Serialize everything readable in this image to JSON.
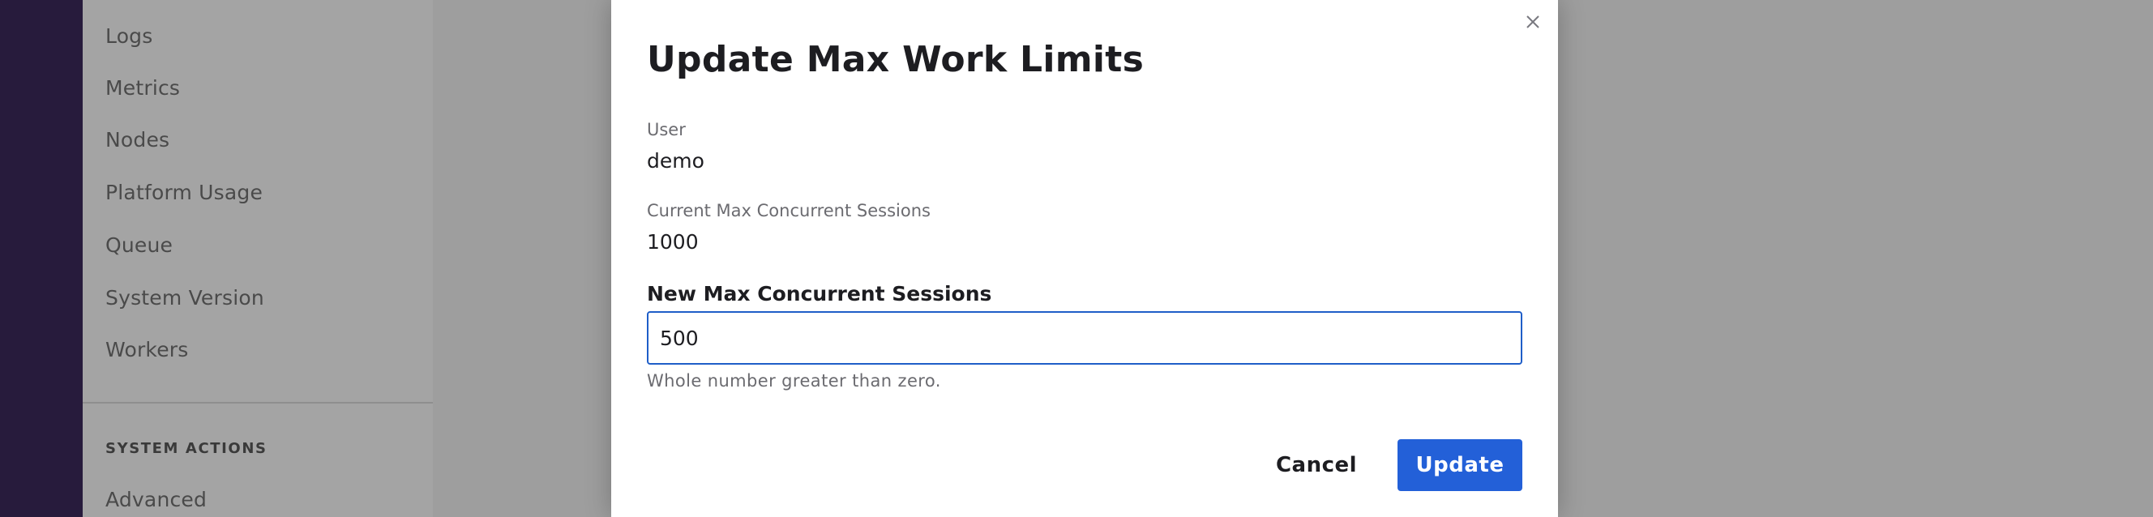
{
  "sidebar": {
    "items": [
      {
        "label": "Logs"
      },
      {
        "label": "Metrics"
      },
      {
        "label": "Nodes"
      },
      {
        "label": "Platform Usage"
      },
      {
        "label": "Queue"
      },
      {
        "label": "System Version"
      },
      {
        "label": "Workers"
      }
    ],
    "section_heading": "SYSTEM ACTIONS",
    "section_items": [
      {
        "label": "Advanced"
      }
    ]
  },
  "modal": {
    "title": "Update Max Work Limits",
    "close_icon": "close-icon",
    "user_label": "User",
    "user_value": "demo",
    "current_label": "Current Max Concurrent Sessions",
    "current_value": "1000",
    "new_label": "New Max Concurrent Sessions",
    "new_value": "500",
    "help_text": "Whole number greater than zero.",
    "cancel_label": "Cancel",
    "update_label": "Update"
  },
  "colors": {
    "primary": "#2360d8",
    "rail": "#271b3c",
    "focus_border": "#1f5ec8"
  }
}
